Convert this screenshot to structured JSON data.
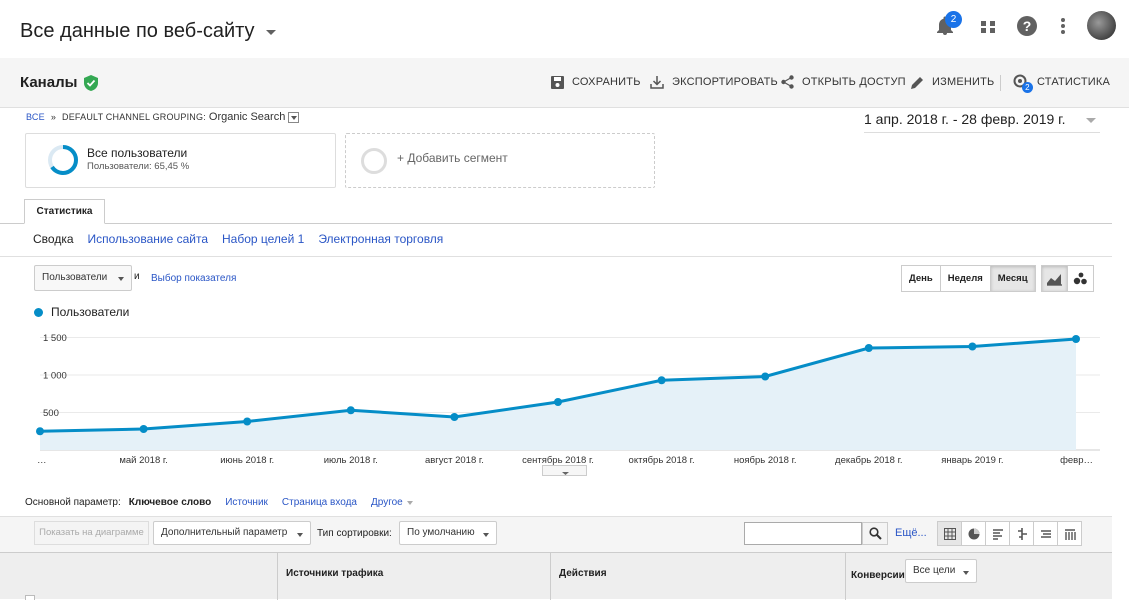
{
  "topbar": {
    "title": "Все данные по веб-сайту",
    "notifications_count": "2",
    "icons": [
      "bell-icon",
      "apps-grid-icon",
      "help-icon",
      "more-vert-icon",
      "avatar"
    ]
  },
  "header": {
    "title": "Каналы",
    "toolbar": {
      "save": "СОХРАНИТЬ",
      "export": "ЭКСПОРТИРОВАТЬ",
      "share": "ОТКРЫТЬ ДОСТУП",
      "edit": "ИЗМЕНИТЬ",
      "insights": "СТАТИСТИКА",
      "insights_count": "2"
    }
  },
  "breadcrumb": {
    "all": "ВСЕ",
    "sep": "»",
    "grouping": "DEFAULT CHANNEL GROUPING:",
    "value": "Organic Search"
  },
  "date_range": "1 апр. 2018 г. - 28 февр. 2019 г.",
  "segments": {
    "active_title": "Все пользователи",
    "active_sub": "Пользователи: 65,45 %",
    "add_label": "+ Добавить сегмент"
  },
  "tabs": {
    "main": "Статистика",
    "sub": [
      "Сводка",
      "Использование сайта",
      "Набор целей 1",
      "Электронная торговля"
    ]
  },
  "metric": {
    "selected": "Пользователи",
    "and": "и",
    "pick": "Выбор показателя"
  },
  "period": [
    "День",
    "Неделя",
    "Месяц"
  ],
  "period_active": "Месяц",
  "chart_data": {
    "type": "area",
    "series": [
      {
        "name": "Пользователи",
        "values": [
          250,
          280,
          380,
          530,
          440,
          640,
          930,
          980,
          1360,
          1380,
          1480
        ]
      }
    ],
    "x": [
      "…",
      "май 2018 г.",
      "июнь 2018 г.",
      "июль 2018 г.",
      "август 2018 г.",
      "сентябрь 2018 г.",
      "октябрь 2018 г.",
      "ноябрь 2018 г.",
      "декабрь 2018 г.",
      "январь 2019 г.",
      "февр…"
    ],
    "yticks": [
      "1 500",
      "1 000",
      "500"
    ],
    "ytick_values": [
      1500,
      1000,
      500
    ],
    "ylim": [
      0,
      1600
    ],
    "color": "#058dc7",
    "fill": "#e5f1f8"
  },
  "dimensions": {
    "label": "Основной параметр:",
    "current": "Ключевое слово",
    "options": [
      "Источник",
      "Страница входа"
    ],
    "more": "Другое"
  },
  "table_toolbar": {
    "plot": "Показать на диаграмме",
    "secondary": "Дополнительный параметр",
    "sort_label": "Тип сортировки:",
    "sort_value": "По умолчанию",
    "more": "Ещё..."
  },
  "table_header": {
    "groups": [
      "Источники трафика",
      "Действия",
      "Конверсии"
    ],
    "goal_select": "Все цели"
  }
}
